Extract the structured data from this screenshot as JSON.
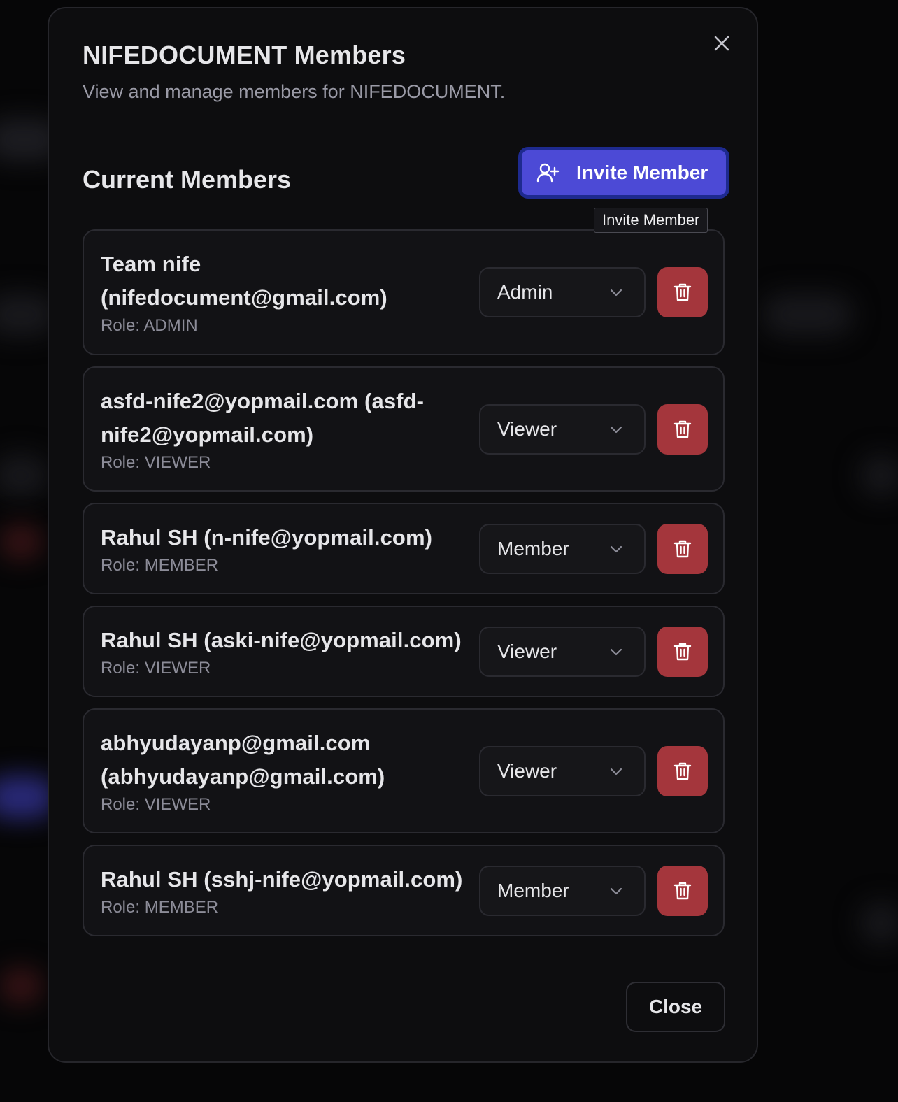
{
  "modal": {
    "title": "NIFEDOCUMENT Members",
    "subtitle": "View and manage members for NIFEDOCUMENT.",
    "section_title": "Current Members",
    "invite_label": "Invite Member",
    "tooltip": "Invite Member",
    "close_label": "Close"
  },
  "members": [
    {
      "name": "Team nife (nifedocument@gmail.com)",
      "role": "Role: ADMIN",
      "selected_role": "Admin"
    },
    {
      "name": "asfd-nife2@yopmail.com (asfd-nife2@yopmail.com)",
      "role": "Role: VIEWER",
      "selected_role": "Viewer"
    },
    {
      "name": "Rahul SH (n-nife@yopmail.com)",
      "role": "Role: MEMBER",
      "selected_role": "Member"
    },
    {
      "name": "Rahul SH (aski-nife@yopmail.com)",
      "role": "Role: VIEWER",
      "selected_role": "Viewer"
    },
    {
      "name": "abhyudayanp@gmail.com (abhyudayanp@gmail.com)",
      "role": "Role: VIEWER",
      "selected_role": "Viewer"
    },
    {
      "name": "Rahul SH (sshj-nife@yopmail.com)",
      "role": "Role: MEMBER",
      "selected_role": "Member"
    }
  ],
  "icons": {
    "close": "close-icon",
    "invite": "user-plus-icon",
    "dropdown": "chevron-down-icon",
    "delete": "trash-icon"
  },
  "colors": {
    "accent": "#4c4ad6",
    "danger": "#a4363c",
    "background": "#0d0d0f"
  }
}
